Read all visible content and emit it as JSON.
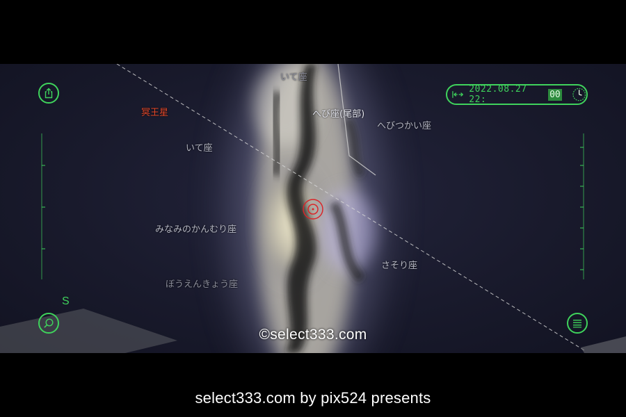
{
  "sky_labels": {
    "ite_top": "いて座",
    "pluto": "冥王星",
    "hebi_tail": "へび座(尾部)",
    "hebitsukai": "へびつかい座",
    "ite_left": "いて座",
    "minami_kanmuri": "みなみのかんむり座",
    "sasori": "さそり座",
    "bouenkyou": "ぼうえんきょう座"
  },
  "datetime": {
    "date_hour": "2022.08.27 22:",
    "minute": "00"
  },
  "compass": {
    "direction": "S"
  },
  "icons": {
    "share": "share-icon",
    "search": "search-icon",
    "menu": "menu-list-icon",
    "time_jump": "time-jump-icon",
    "clock": "clock-icon",
    "target": "target-reticle-icon"
  },
  "watermark": "©select333.com",
  "footer": "select333.com by pix524 presents",
  "colors": {
    "ui_green": "#3fd35c",
    "planet_label": "#e5482a",
    "sky_background": "#1a1b2e",
    "target": "#d9262a"
  }
}
